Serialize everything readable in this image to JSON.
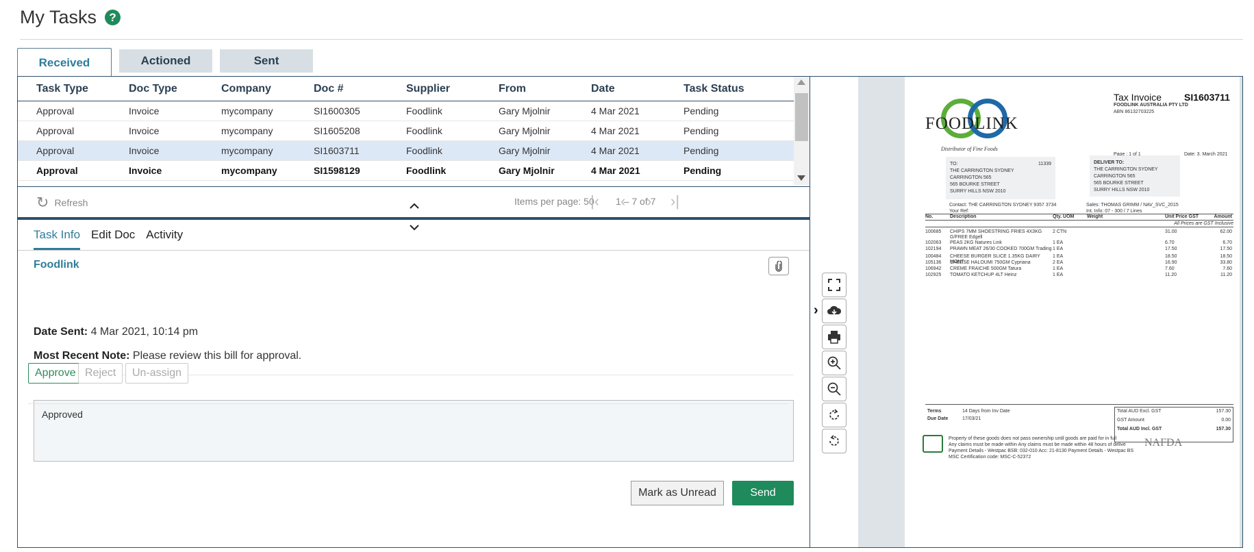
{
  "page": {
    "title": "My Tasks",
    "help": "?"
  },
  "tabs": [
    {
      "label": "Received",
      "active": true
    },
    {
      "label": "Actioned",
      "active": false
    },
    {
      "label": "Sent",
      "active": false
    }
  ],
  "grid": {
    "columns": [
      "Task Type",
      "Doc Type",
      "Company",
      "Doc #",
      "Supplier",
      "From",
      "Date",
      "Task Status"
    ],
    "rows": [
      [
        "Approval",
        "Invoice",
        "mycompany",
        "SI1600305",
        "Foodlink",
        "Gary Mjolnir",
        "4 Mar 2021",
        "Pending"
      ],
      [
        "Approval",
        "Invoice",
        "mycompany",
        "SI1605208",
        "Foodlink",
        "Gary Mjolnir",
        "4 Mar 2021",
        "Pending"
      ],
      [
        "Approval",
        "Invoice",
        "mycompany",
        "SI1603711",
        "Foodlink",
        "Gary Mjolnir",
        "4 Mar 2021",
        "Pending"
      ],
      [
        "Approval",
        "Invoice",
        "mycompany",
        "SI1598129",
        "Foodlink",
        "Gary Mjolnir",
        "4 Mar 2021",
        "Pending"
      ]
    ],
    "selected_row": 2,
    "bold_row": 3
  },
  "pager": {
    "refresh": "Refresh",
    "items_per_page_label": "Items per page:",
    "items_per_page": "50",
    "range": "1 – 7 of 7"
  },
  "info_tabs": [
    {
      "label": "Task Info",
      "active": true
    },
    {
      "label": "Edit Doc",
      "active": false
    },
    {
      "label": "Activity",
      "active": false
    }
  ],
  "task_info": {
    "supplier": "Foodlink",
    "date_sent_label": "Date Sent:",
    "date_sent": "4 Mar 2021, 10:14 pm",
    "note_label": "Most Recent Note:",
    "note": "Please review this bill for approval."
  },
  "actions": {
    "approve": "Approve",
    "reject": "Reject",
    "unassign": "Un-assign",
    "comment": "Approved",
    "mark_unread": "Mark as Unread",
    "send": "Send"
  },
  "invoice": {
    "logo_text": "FOODLINK",
    "logo_tagline": "Distributor of Fine Foods",
    "title": "Tax Invoice",
    "number": "SI1603711",
    "company": "FOODLINK AUSTRALIA PTY LTD",
    "abn": "ABN      86132703225",
    "page": "Page : 1 of 1",
    "date": "Date:  3. March 2021",
    "to_label": "TO:",
    "to_code": "11339",
    "to_lines": [
      "THE CARRINGTON SYDNEY",
      "CARRINGTON 565",
      "565 BOURKE STREET",
      "SURRY HILLS NSW  2010"
    ],
    "deliver_label": "DELIVER TO:",
    "deliver_lines": [
      "THE CARRINGTON SYDNEY",
      "CARRINGTON 565",
      "565 BOURKE STREET",
      "SURRY HILLS NSW  2010"
    ],
    "contact": "Contact:   THE CARRINGTON SYDNEY  9357 3734",
    "your_ref": "Your Ref:",
    "sales": "Sales:    THOMAS GRIMM / NAV_SVC_2015",
    "int_info": "Int. Info:   07 - 300 / 7 Lines",
    "headers": [
      "No.",
      "Description",
      "Qty. UOM",
      "Weight",
      "Unit Price  GST",
      "Amount"
    ],
    "price_note": "All Prices are GST Inclusive",
    "lines": [
      [
        "100685",
        "CHIPS 7MM SHOESTRING FRIES 4X3KG G/FREE Edgell",
        "2 CTN",
        "31.00",
        "62.00"
      ],
      [
        "102063",
        "PEAS 2KG Natures Link",
        "1 EA",
        "6.70",
        "6.70"
      ],
      [
        "102194",
        "PRAWN MEAT 26/30 COOKED 700GM Trading",
        "1 EA",
        "17.50",
        "17.50"
      ],
      [
        "100484",
        "CHEESE BURGER SLICE 1.35KG DAIRY MONT",
        "1 EA",
        "18.50",
        "18.50"
      ],
      [
        "105136",
        "CHEESE HALOUMI 750GM Cypriana",
        "2 EA",
        "16.90",
        "33.80"
      ],
      [
        "106942",
        "CREME FRAICHE 500GM Tatura",
        "1 EA",
        "7.60",
        "7.60"
      ],
      [
        "102925",
        "TOMATO KETCHUP 4LT Heinz",
        "1 EA",
        "11.20",
        "11.20"
      ]
    ],
    "terms_label": "Terms",
    "terms": "14 Days from Inv Date",
    "due_label": "Due Date",
    "due": "17/03/21",
    "total_excl_label": "Total AUD Excl. GST",
    "total_excl": "157.30",
    "gst_label": "GST Amount",
    "gst": "0.00",
    "total_incl_label": "Total AUD Incl. GST",
    "total_incl": "157.30",
    "footer_lines": [
      "Property of these goods does not pass ownership until goods are paid for in full",
      "Any claims must be made within Any claims must be made within 48 hours of delive",
      "Payment Details - Westpac BSB: 032-010 Acc: 21-8130 Payment Details - Westpac BS",
      "MSC Certification code: MSC-C-52372"
    ],
    "nafda": "NAFDA"
  },
  "colors": {
    "accent": "#2e7d9a",
    "success": "#1f8a5b",
    "border": "#2d4f6b"
  }
}
